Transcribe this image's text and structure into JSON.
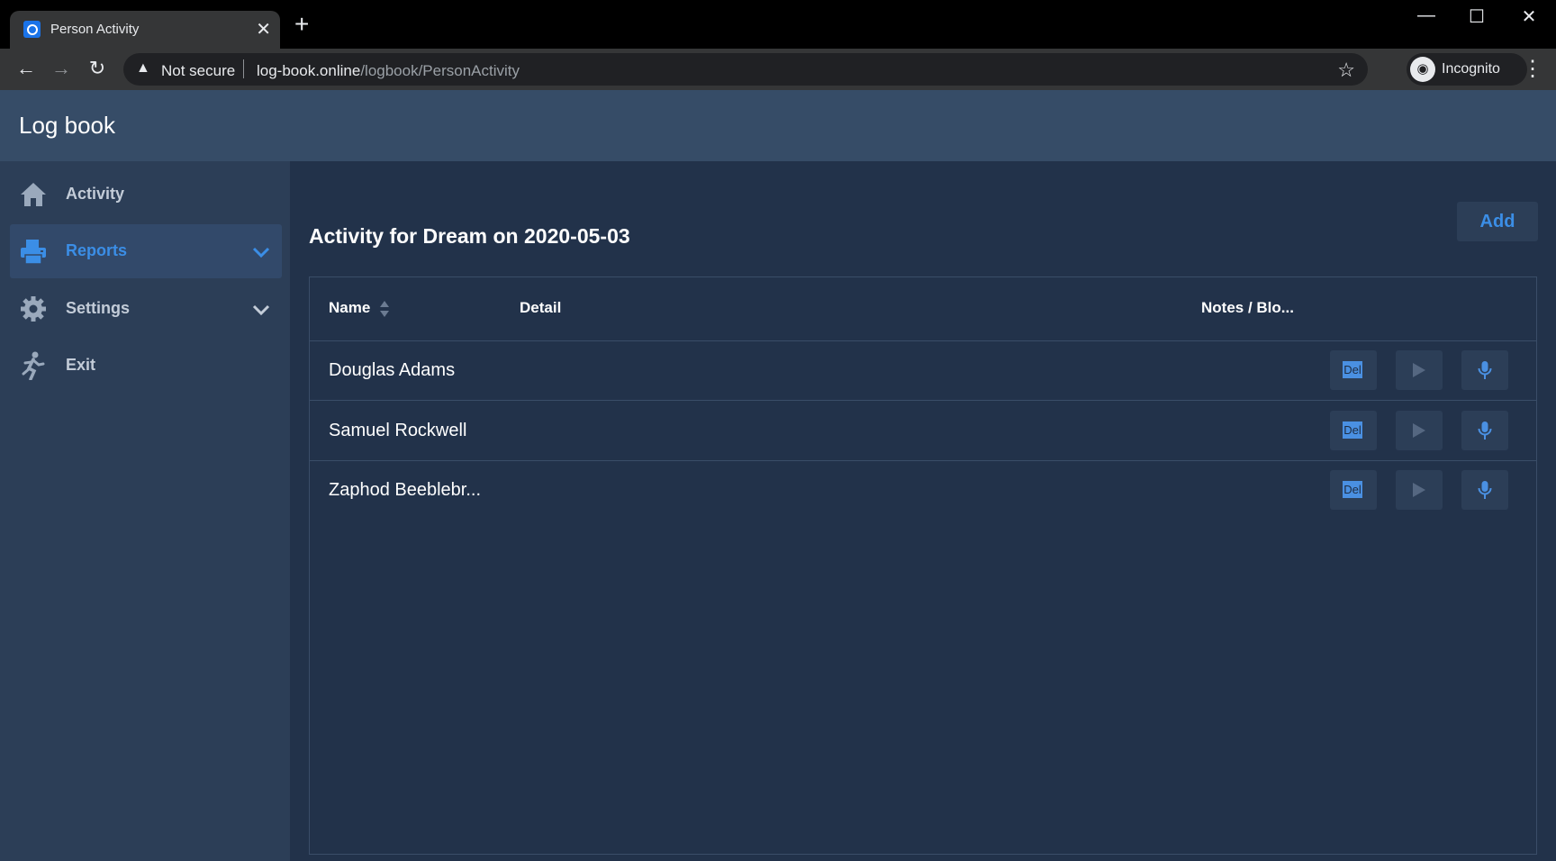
{
  "browser": {
    "tab_title": "Person Activity",
    "tab_close": "✕",
    "new_tab": "+",
    "security_label": "Not secure",
    "url_host": "log-book.online",
    "url_path": "/logbook/PersonActivity",
    "profile_label": "Incognito",
    "window_controls": [
      "—",
      "☐",
      "✕"
    ]
  },
  "app": {
    "title": "Log book",
    "accent_color": "#3b8ee6",
    "sidebar": {
      "items": [
        {
          "label": "Activity",
          "icon": "home-icon",
          "active": false,
          "expandable": false
        },
        {
          "label": "Reports",
          "icon": "printer-icon",
          "active": true,
          "expandable": true
        },
        {
          "label": "Settings",
          "icon": "gear-icon",
          "active": false,
          "expandable": true
        },
        {
          "label": "Exit",
          "icon": "running-person-icon",
          "active": false,
          "expandable": false
        }
      ]
    },
    "main": {
      "title": "Activity for Dream on 2020-05-03",
      "add_label": "Add",
      "table": {
        "columns": [
          "Name",
          "Detail",
          "Notes / Blo..."
        ],
        "rows": [
          {
            "name": "Douglas Adams",
            "detail": "",
            "notes": ""
          },
          {
            "name": "Samuel Rockwell",
            "detail": "",
            "notes": ""
          },
          {
            "name": "Zaphod Beeblebr...",
            "detail": "",
            "notes": ""
          }
        ],
        "row_actions": {
          "delete_label": "Del",
          "play_icon": "play-icon",
          "record_icon": "microphone-icon"
        }
      }
    }
  }
}
